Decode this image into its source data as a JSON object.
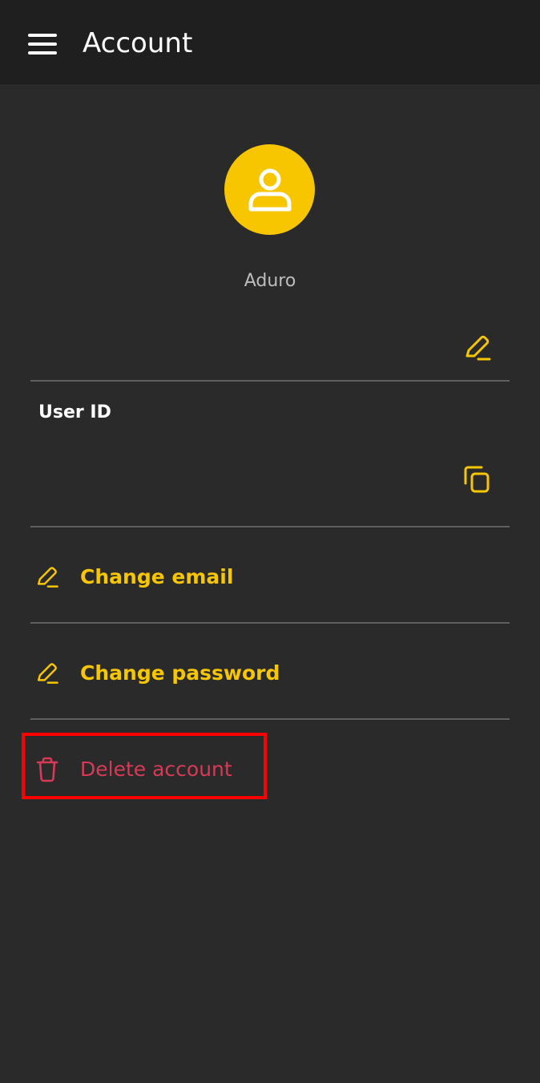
{
  "appbar": {
    "title": "Account",
    "menu_icon": "menu-icon"
  },
  "profile": {
    "avatar_icon": "user-icon",
    "avatar_color": "#f7c600",
    "username": "Aduro",
    "edit_icon": "pencil-icon"
  },
  "user_id": {
    "label": "User ID",
    "value": "",
    "copy_icon": "copy-icon"
  },
  "actions": [
    {
      "label": "Change email",
      "icon": "pencil-icon",
      "color": "#f7c600"
    },
    {
      "label": "Change password",
      "icon": "pencil-icon",
      "color": "#f7c600"
    },
    {
      "label": "Delete account",
      "icon": "trash-icon",
      "color": "#d63a57"
    }
  ],
  "annotation": {
    "highlight_color": "#ff0000",
    "highlighted_item": "Delete account"
  }
}
